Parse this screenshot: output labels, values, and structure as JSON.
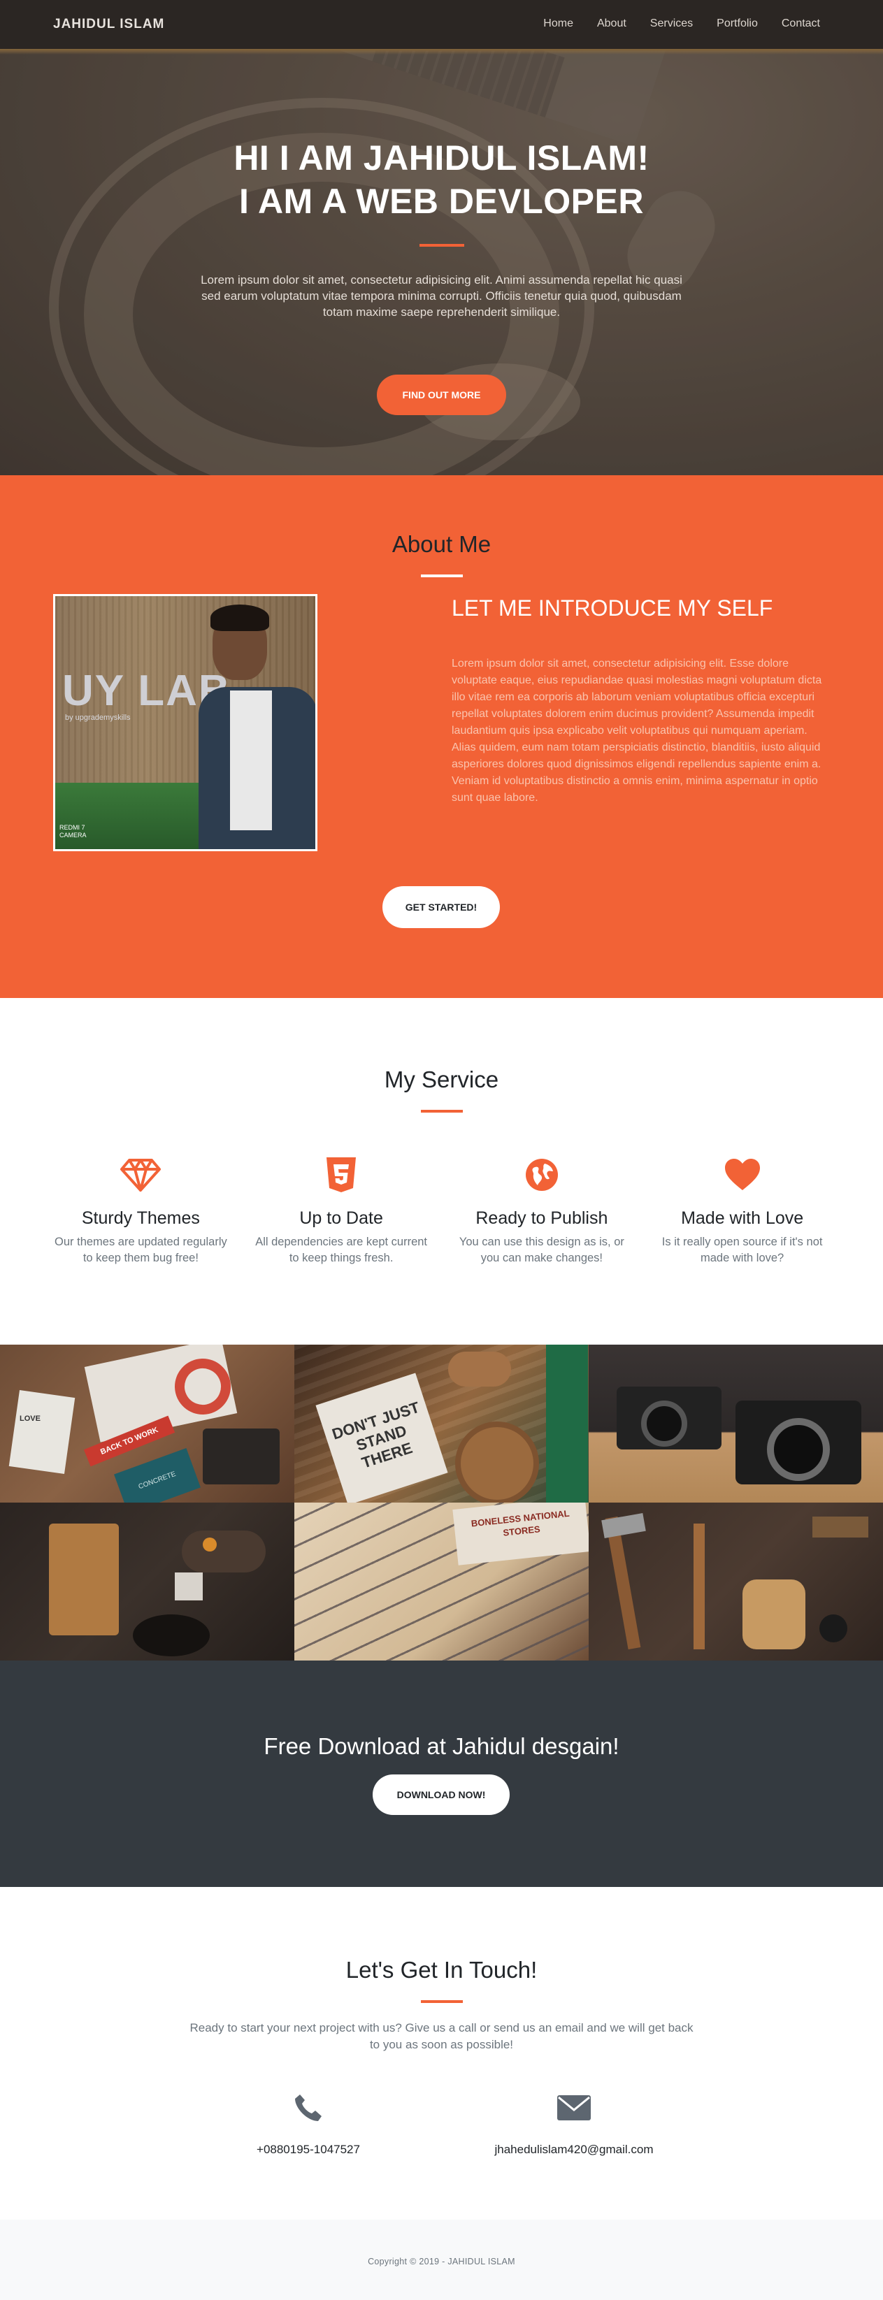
{
  "nav": {
    "brand": "JAHIDUL ISLAM",
    "links": [
      "Home",
      "About",
      "Services",
      "Portfolio",
      "Contact"
    ]
  },
  "hero": {
    "title_line1": "HI I AM JAHIDUL ISLAM!",
    "title_line2": "I AM A WEB DEVLOPER",
    "text": "Lorem ipsum dolor sit amet, consectetur adipisicing elit. Animi assumenda repellat hic quasi sed earum voluptatum vitae tempora minima corrupti. Officiis tenetur quia quod, quibusdam totam maxime saepe reprehenderit similique.",
    "button": "FIND OUT MORE"
  },
  "about": {
    "title": "About Me",
    "photo_sign": "UY LAB",
    "photo_sub": "by upgrademyskills",
    "photo_caption_1": "REDMI 7",
    "photo_caption_2": "CAMERA",
    "intro_title": "LET ME INTRODUCE MY SELF",
    "intro_text": "Lorem ipsum dolor sit amet, consectetur adipisicing elit. Esse dolore voluptate eaque, eius repudiandae quasi molestias magni voluptatum dicta illo vitae rem ea corporis ab laborum veniam voluptatibus officia excepturi repellat voluptates dolorem enim ducimus provident? Assumenda impedit laudantium quis ipsa explicabo velit voluptatibus qui numquam aperiam. Alias quidem, eum nam totam perspiciatis distinctio, blanditiis, iusto aliquid asperiores dolores quod dignissimos eligendi repellendus sapiente enim a. Veniam id voluptatibus distinctio a omnis enim, minima aspernatur in optio sunt quae labore.",
    "button": "GET STARTED!"
  },
  "service": {
    "title": "My Service",
    "items": [
      {
        "icon": "diamond-icon",
        "title": "Sturdy Themes",
        "text": "Our themes are updated regularly to keep them bug free!"
      },
      {
        "icon": "html5-icon",
        "title": "Up to Date",
        "text": "All dependencies are kept current to keep things fresh."
      },
      {
        "icon": "globe-icon",
        "title": "Ready to Publish",
        "text": "You can use this design as is, or you can make changes!"
      },
      {
        "icon": "heart-icon",
        "title": "Made with Love",
        "text": "Is it really open source if it's not made with love?"
      }
    ]
  },
  "portfolio": {
    "tile_texts": {
      "t1_flag": "BACK TO WORK",
      "t1_card": "LOVE",
      "t1_book": "CONCRETE",
      "t2_book": "DON'T JUST STAND THERE",
      "t5_sign": "BONELESS NATIONAL STORES"
    }
  },
  "download": {
    "title": "Free Download at Jahidul desgain!",
    "button": "DOWNLOAD NOW!"
  },
  "contact": {
    "title": "Let's Get In Touch!",
    "text": "Ready to start your next project with us? Give us a call or send us an email and we will get back to you as soon as possible!",
    "phone": "+0880195-1047527",
    "email": "jhahedulislam420@gmail.com"
  },
  "footer": {
    "copyright": "Copyright © 2019 - JAHIDUL ISLAM"
  },
  "colors": {
    "accent": "#f26236",
    "dark": "#343a40",
    "icon_gray": "#5d6670"
  }
}
